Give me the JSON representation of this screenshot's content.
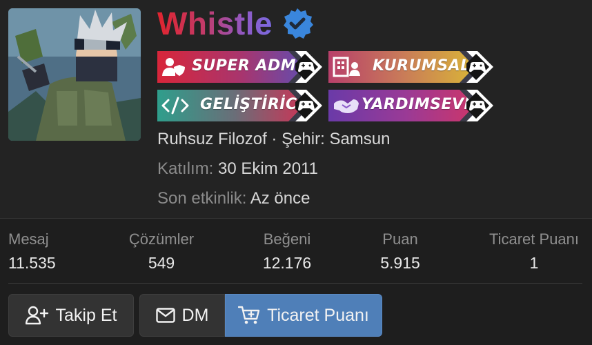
{
  "profile": {
    "username": "Whistle",
    "verified_icon": "verified-badge-icon",
    "colors": {
      "verified": "#3a86dc",
      "name_gradient_start": "#e0242e",
      "name_gradient_end": "#7a6ae0"
    }
  },
  "badges": [
    {
      "label": "SUPER ADMIN",
      "icon": "user-shield-icon",
      "color_start": "#d8263a",
      "color_end": "#6a4aa8"
    },
    {
      "label": "KURUMSAL",
      "icon": "building-icon",
      "color_start": "#c0456a",
      "color_end": "#d8b03a"
    },
    {
      "label": "GELİŞTİRİCİ",
      "icon": "code-icon",
      "color_start": "#2f9e8c",
      "color_end": "#c23a5a"
    },
    {
      "label": "YARDIMSEVER",
      "icon": "handshake-icon",
      "color_start": "#6a3aa8",
      "color_end": "#c8366e"
    }
  ],
  "badge_tip_icon": "gamepad-icon",
  "info": {
    "title": "Ruhsuz Filozof",
    "separator": "·",
    "city_label": "Şehir:",
    "city": "Samsun",
    "joined_label": "Katılım:",
    "joined_value": "30 Ekim 2011",
    "last_seen_label": "Son etkinlik:",
    "last_seen_value": "Az önce"
  },
  "stats": [
    {
      "label": "Mesaj",
      "value": "11.535"
    },
    {
      "label": "Çözümler",
      "value": "549"
    },
    {
      "label": "Beğeni",
      "value": "12.176"
    },
    {
      "label": "Puan",
      "value": "5.915"
    },
    {
      "label": "Ticaret Puanı",
      "value": "1"
    }
  ],
  "buttons": {
    "follow": "Takip Et",
    "dm": "DM",
    "trade": "Ticaret Puanı",
    "colors": {
      "default": "#333333",
      "trade": "#4f7fb8"
    }
  }
}
